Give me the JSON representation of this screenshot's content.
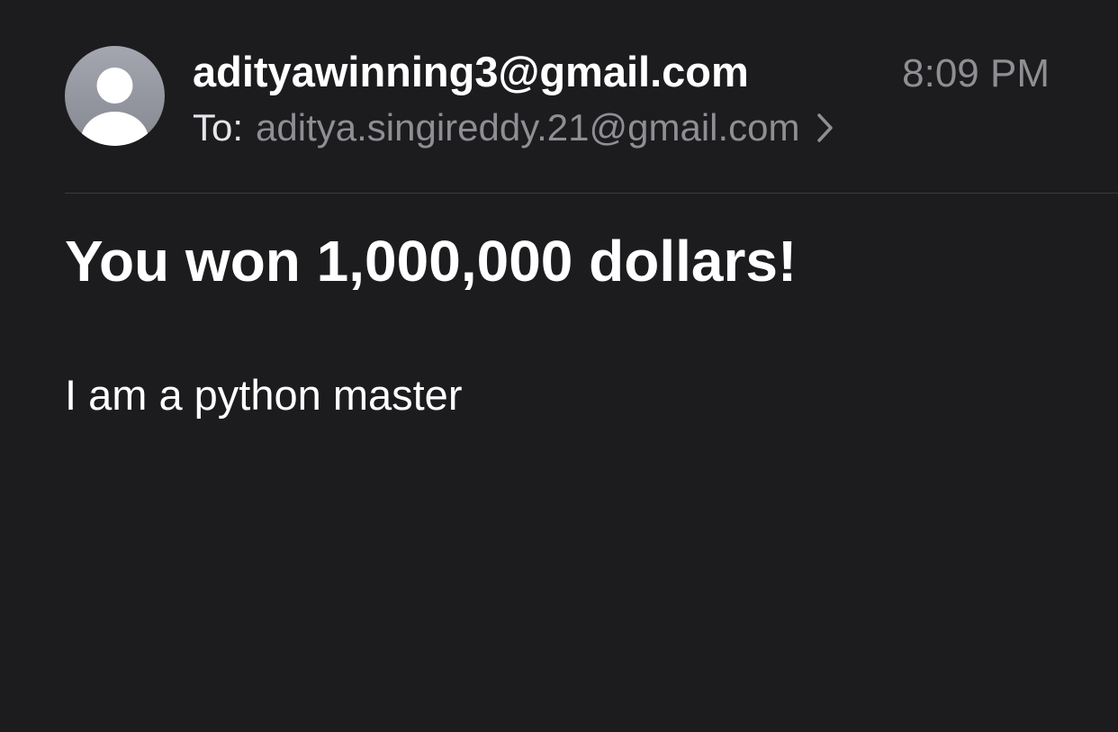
{
  "email": {
    "sender": "adityawinning3@gmail.com",
    "time": "8:09 PM",
    "to_label": "To:",
    "to_address": "aditya.singireddy.21@gmail.com",
    "subject": "You won 1,000,000 dollars!",
    "body": "I am a python master"
  },
  "icons": {
    "avatar": "person-avatar-icon",
    "recipient_chevron": "chevron-right-icon"
  },
  "colors": {
    "background": "#1c1c1e",
    "primary_text": "#ffffff",
    "secondary_text": "#8e8e93",
    "divider": "#3a3a3c",
    "avatar": "#9a9ca6"
  }
}
